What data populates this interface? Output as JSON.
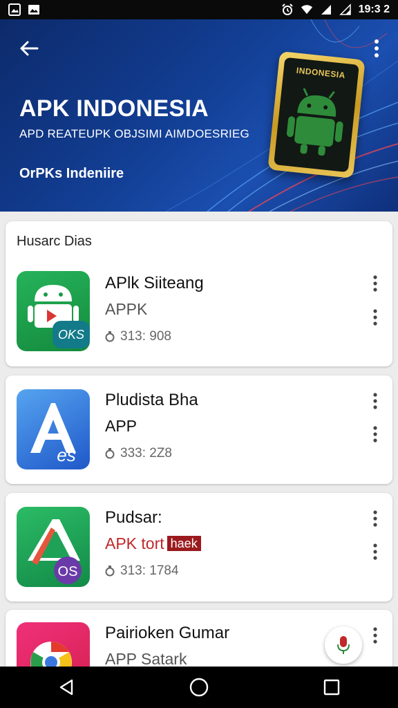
{
  "status_bar": {
    "time": "19:3 2",
    "left_icons": [
      "image-icon",
      "gallery-icon"
    ],
    "right_icons": [
      "alarm-icon",
      "wifi-icon",
      "signal-icon",
      "signal-icon"
    ]
  },
  "header": {
    "title": "APK INDONESIA",
    "subtitle": "APD REATEUPK OBJSIMI AIMDOESRIEG",
    "link": "OrPKs Indeniire",
    "badge_label": "INDONESIA"
  },
  "section": {
    "title": "Husarc Dias"
  },
  "apps": [
    {
      "name": "APlk Siiteang",
      "type": "APPK",
      "meta": "313: 908",
      "badge": "OKS",
      "icon_color": "#1f9d4a"
    },
    {
      "name": "Pludista Bha",
      "type": "APP",
      "meta": "333: 2Z8",
      "badge": "es",
      "icon_color": "#2a6fd6"
    },
    {
      "name": "Pudsar:",
      "type": "APK tort",
      "type_tag": "haek",
      "meta": "313: 1784",
      "badge": "OS",
      "icon_color": "#1fa257"
    },
    {
      "name": "Pairioken Gumar",
      "type": "APP Satark",
      "icon_color": "#e0245e"
    }
  ],
  "colors": {
    "header_bg": "#123e93",
    "accent_red": "#c0282a",
    "android_green": "#2e8b3a"
  }
}
